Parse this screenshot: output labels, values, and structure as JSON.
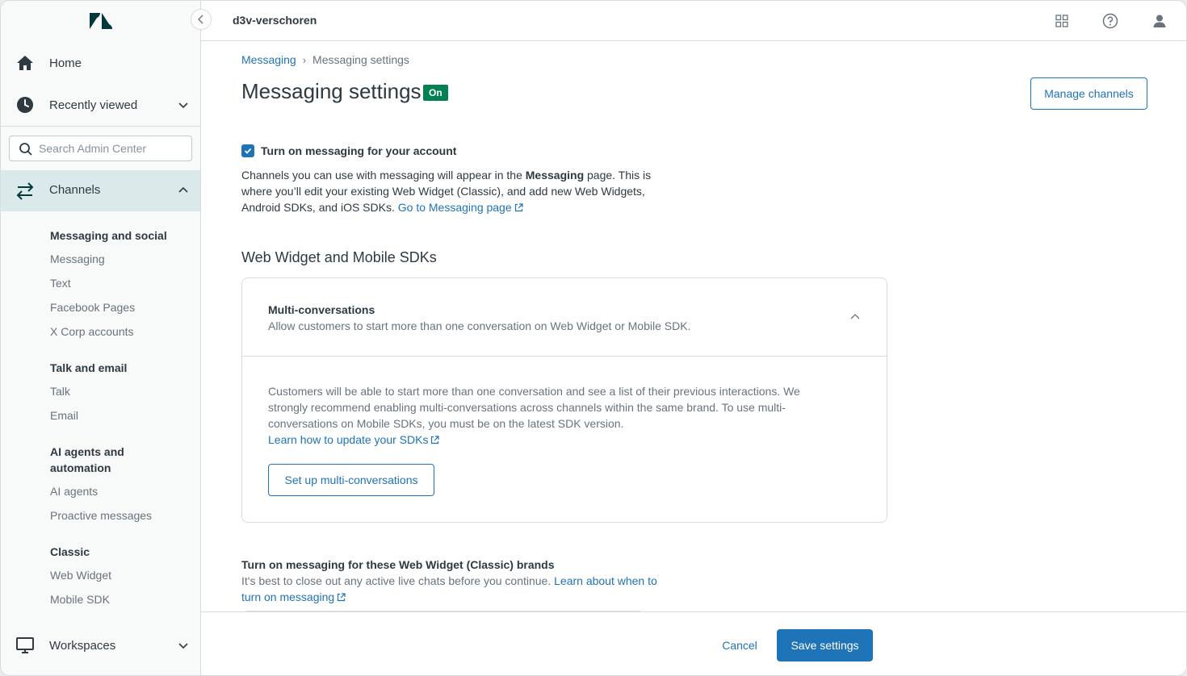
{
  "sidebar": {
    "home_label": "Home",
    "recent_label": "Recently viewed",
    "search_placeholder": "Search Admin Center",
    "channels_label": "Channels",
    "groups": [
      {
        "title": "Messaging and social",
        "items": [
          "Messaging",
          "Text",
          "Facebook Pages",
          "X Corp accounts"
        ]
      },
      {
        "title": "Talk and email",
        "items": [
          "Talk",
          "Email"
        ]
      },
      {
        "title_line1": "AI agents and",
        "title_line2": "automation",
        "items": [
          "AI agents",
          "Proactive messages"
        ]
      },
      {
        "title": "Classic",
        "items": [
          "Web Widget",
          "Mobile SDK"
        ]
      }
    ],
    "workspaces_label": "Workspaces"
  },
  "topbar": {
    "account_name": "d3v-verschoren"
  },
  "breadcrumb": {
    "parent": "Messaging",
    "separator": "›",
    "current": "Messaging settings"
  },
  "page": {
    "title": "Messaging settings",
    "status_badge": "On",
    "manage_button": "Manage channels"
  },
  "messaging_toggle": {
    "label": "Turn on messaging for your account",
    "checked": true,
    "desc_part1": "Channels you can use with messaging will appear in the ",
    "desc_bold": "Messaging",
    "desc_part2": " page. This is where you’ll edit your existing Web Widget (Classic), and add new Web Widgets, Android SDKs, and iOS SDKs. ",
    "link": "Go to Messaging page"
  },
  "web_widget_section": {
    "title": "Web Widget and Mobile SDKs"
  },
  "multi_conv_card": {
    "title": "Multi-conversations",
    "subtitle": "Allow customers to start more than one conversation on Web Widget or Mobile SDK.",
    "body": "Customers will be able to start more than one conversation and see a list of their previous interactions. We strongly recommend enabling multi-conversations across channels within the same brand. To use multi-conversations on Mobile SDKs, you must be on the latest SDK version.",
    "link": "Learn how to update your SDKs",
    "button": "Set up multi-conversations"
  },
  "classic_section": {
    "title": "Turn on messaging for these Web Widget (Classic) brands",
    "desc": "It's best to close out any active live chats before you continue. ",
    "link_line1": "Learn about when to",
    "link_line2": "turn on messaging"
  },
  "footer": {
    "cancel": "Cancel",
    "save": "Save settings"
  },
  "colors": {
    "accent": "#1f73b7",
    "status_on": "#038153",
    "active_nav_bg": "#dae9ea",
    "text": "#2f3941"
  },
  "icons": [
    "zendesk-logo",
    "home-icon",
    "clock-icon",
    "chevron-down-icon",
    "search-icon",
    "arrows-swap-icon",
    "chevron-up-icon",
    "monitor-icon",
    "chevron-left-icon",
    "grid-icon",
    "help-icon",
    "user-icon",
    "external-link-icon",
    "check-icon"
  ]
}
